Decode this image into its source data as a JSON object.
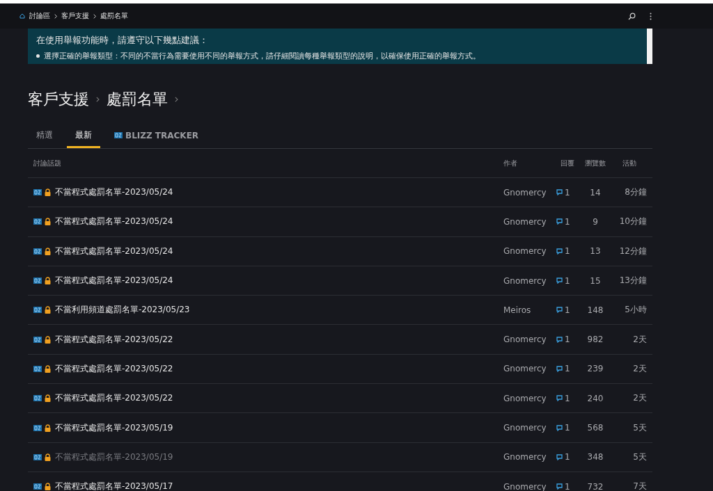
{
  "breadcrumb": [
    "討論區",
    "客戶支援",
    "處罰名單"
  ],
  "banner": {
    "heading": "在使用舉報功能時，請遵守以下幾點建議：",
    "items": [
      "選擇正確的舉報類型：不同的不當行為需要使用不同的舉報方式，請仔細閱讀每種舉報類型的說明，以確保使用正確的舉報方式。"
    ]
  },
  "title": [
    "客戶支援",
    "處罰名單"
  ],
  "tabs": [
    {
      "label": "精選",
      "selected": false,
      "kind": "text"
    },
    {
      "label": "最新",
      "selected": true,
      "kind": "text"
    },
    {
      "label": "BLIZZ TRACKER",
      "selected": false,
      "kind": "tracker"
    }
  ],
  "table": {
    "columns": [
      "討論話題",
      "作者",
      "回覆",
      "瀏覽數",
      "活動"
    ],
    "rows": [
      {
        "title": "不當程式處罰名單-2023/05/24",
        "author": "Gnomercy",
        "replies": "1",
        "views": "14",
        "activity": "8分鐘",
        "read": false
      },
      {
        "title": "不當程式處罰名單-2023/05/24",
        "author": "Gnomercy",
        "replies": "1",
        "views": "9",
        "activity": "10分鐘",
        "read": false
      },
      {
        "title": "不當程式處罰名單-2023/05/24",
        "author": "Gnomercy",
        "replies": "1",
        "views": "13",
        "activity": "12分鐘",
        "read": false
      },
      {
        "title": "不當程式處罰名單-2023/05/24",
        "author": "Gnomercy",
        "replies": "1",
        "views": "15",
        "activity": "13分鐘",
        "read": false
      },
      {
        "title": "不當利用頻道處罰名單-2023/05/23",
        "author": "Meiros",
        "replies": "1",
        "views": "148",
        "activity": "5小時",
        "read": false
      },
      {
        "title": "不當程式處罰名單-2023/05/22",
        "author": "Gnomercy",
        "replies": "1",
        "views": "982",
        "activity": "2天",
        "read": false
      },
      {
        "title": "不當程式處罰名單-2023/05/22",
        "author": "Gnomercy",
        "replies": "1",
        "views": "239",
        "activity": "2天",
        "read": false
      },
      {
        "title": "不當程式處罰名單-2023/05/22",
        "author": "Gnomercy",
        "replies": "1",
        "views": "240",
        "activity": "2天",
        "read": false
      },
      {
        "title": "不當程式處罰名單-2023/05/19",
        "author": "Gnomercy",
        "replies": "1",
        "views": "568",
        "activity": "5天",
        "read": false
      },
      {
        "title": "不當程式處罰名單-2023/05/19",
        "author": "Gnomercy",
        "replies": "1",
        "views": "348",
        "activity": "5天",
        "read": true
      },
      {
        "title": "不當程式處罰名單-2023/05/17",
        "author": "Gnomercy",
        "replies": "1",
        "views": "732",
        "activity": "7天",
        "read": false
      }
    ]
  }
}
